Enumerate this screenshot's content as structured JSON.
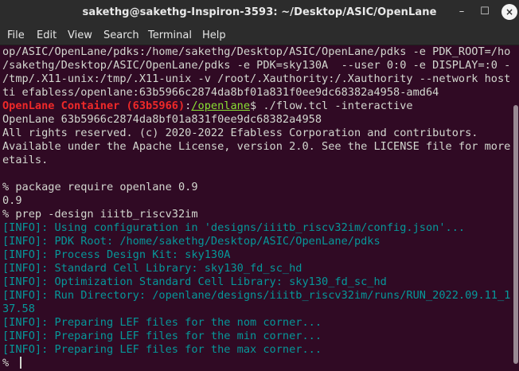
{
  "window": {
    "title": "sakethg@sakethg-Inspiron-3593: ~/Desktop/ASIC/OpenLane",
    "minimize_glyph": "–",
    "maximize_glyph": "☐",
    "close_glyph": "×"
  },
  "menu": [
    "File",
    "Edit",
    "View",
    "Search",
    "Terminal",
    "Help"
  ],
  "terminal": {
    "lines": [
      {
        "text": "op/ASIC/OpenLane/pdks:/home/sakethg/Desktop/ASIC/OpenLane/pdks -e PDK_ROOT=/home"
      },
      {
        "text": "/sakethg/Desktop/ASIC/OpenLane/pdks -e PDK=sky130A  --user 0:0 -e DISPLAY=:0 -v"
      },
      {
        "text": "/tmp/.X11-unix:/tmp/.X11-unix -v /root/.Xauthority:/.Xauthority --network host -"
      },
      {
        "text": "ti efabless/openlane:63b5966c2874da8bf01a831f0ee9dc68382a4958-amd64"
      },
      {
        "prompt_container": "OpenLane Container (63b5966)",
        "prompt_sep": ":",
        "prompt_path": "/openlane",
        "prompt_cmd": "$ ./flow.tcl -interactive"
      },
      {
        "text": "OpenLane 63b5966c2874da8bf01a831f0ee9dc68382a4958"
      },
      {
        "text": "All rights reserved. (c) 2020-2022 Efabless Corporation and contributors."
      },
      {
        "text": "Available under the Apache License, version 2.0. See the LICENSE file for more d"
      },
      {
        "text": "etails."
      },
      {
        "text": ""
      },
      {
        "text": "% package require openlane 0.9"
      },
      {
        "text": "0.9"
      },
      {
        "text": "% prep -design iiitb_riscv32im"
      },
      {
        "text": "[INFO]: Using configuration in 'designs/iiitb_riscv32im/config.json'...",
        "info": true
      },
      {
        "text": "[INFO]: PDK Root: /home/sakethg/Desktop/ASIC/OpenLane/pdks",
        "info": true
      },
      {
        "text": "[INFO]: Process Design Kit: sky130A",
        "info": true
      },
      {
        "text": "[INFO]: Standard Cell Library: sky130_fd_sc_hd",
        "info": true
      },
      {
        "text": "[INFO]: Optimization Standard Cell Library: sky130_fd_sc_hd",
        "info": true
      },
      {
        "text": "[INFO]: Run Directory: /openlane/designs/iiitb_riscv32im/runs/RUN_2022.09.11_16.",
        "info": true
      },
      {
        "text": "37.58",
        "info": true
      },
      {
        "text": "[INFO]: Preparing LEF files for the nom corner...",
        "info": true
      },
      {
        "text": "[INFO]: Preparing LEF files for the min corner...",
        "info": true
      },
      {
        "text": "[INFO]: Preparing LEF files for the max corner...",
        "info": true
      },
      {
        "text": "% ",
        "cursor": true
      }
    ]
  },
  "colors": {
    "background": "#300a24",
    "text": "#d3d7cf",
    "prompt_red": "#ef2929",
    "prompt_green": "#8ae234",
    "info_cyan": "#06989a",
    "titlebar": "#2c2c2c"
  }
}
